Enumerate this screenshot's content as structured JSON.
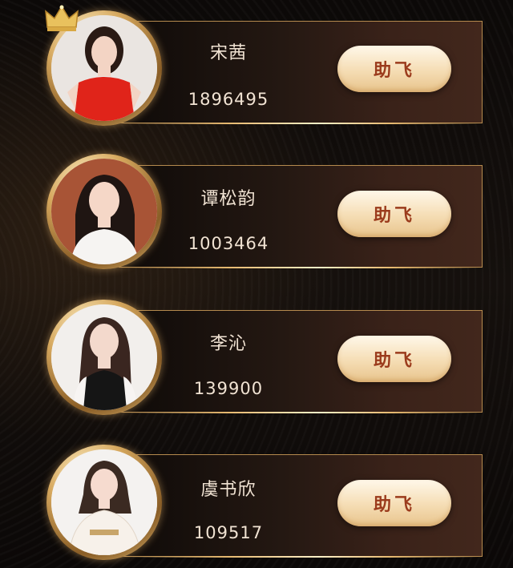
{
  "rank_list": [
    {
      "name": "宋茜",
      "value": "1896495",
      "button_label": "助飞",
      "avatar_colors": {
        "bg": "#eae5e1",
        "hair": "#2a1a14",
        "outfit": "#e0241a",
        "skin": "#f3d4c4"
      }
    },
    {
      "name": "谭松韵",
      "value": "1003464",
      "button_label": "助飞",
      "avatar_colors": {
        "bg": "#a85436",
        "hair": "#1f1512",
        "outfit": "#f6f4f2",
        "skin": "#f5d7c7"
      }
    },
    {
      "name": "李沁",
      "value": "139900",
      "button_label": "助飞",
      "avatar_colors": {
        "bg": "#f2efec",
        "hair": "#3a2620",
        "outfit": "#151515",
        "skin": "#f3d9cc"
      }
    },
    {
      "name": "虞书欣",
      "value": "109517",
      "button_label": "助飞",
      "avatar_colors": {
        "bg": "#f4f2f0",
        "hair": "#3b2a22",
        "outfit": "#f7f1ea",
        "skin": "#f6dbcf"
      }
    }
  ],
  "top_badge_icon": "crown-icon",
  "accent_color": "#c79a57"
}
